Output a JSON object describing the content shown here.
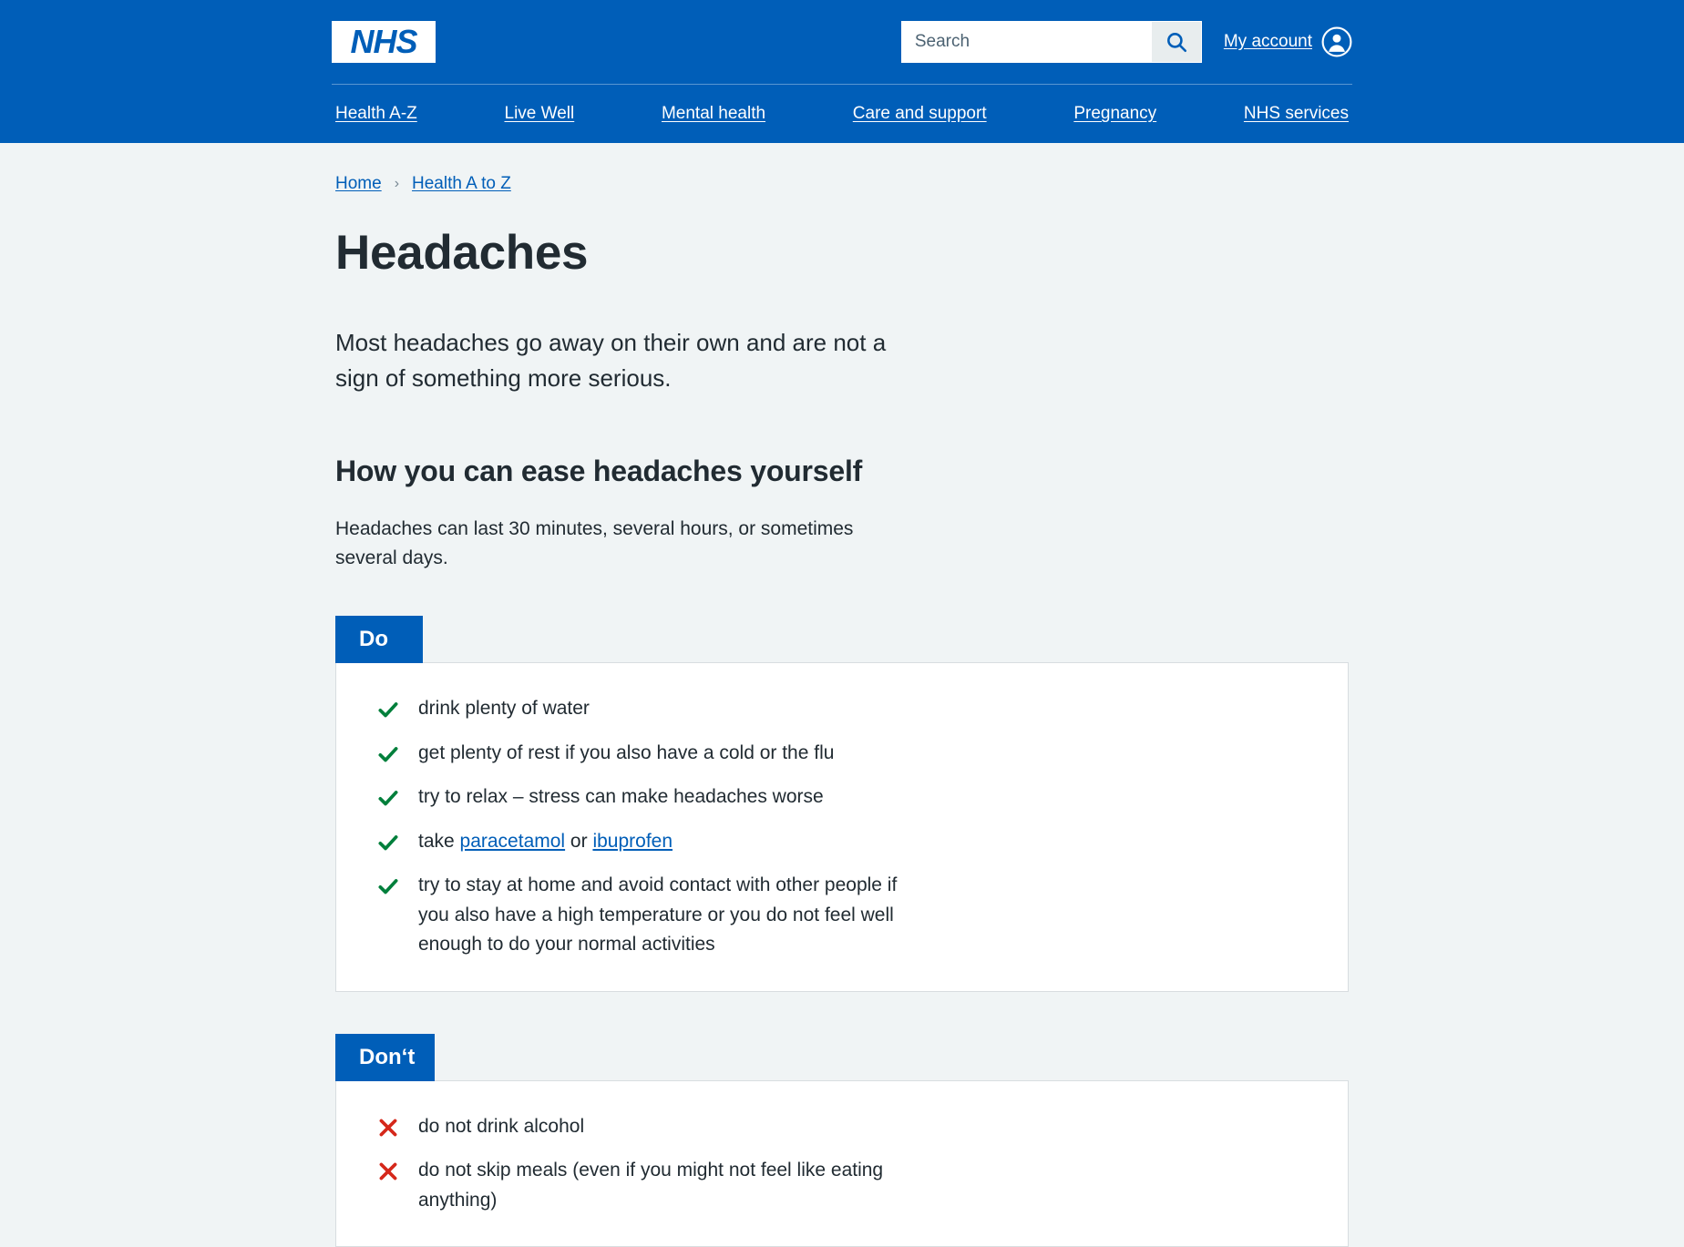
{
  "header": {
    "logo_text": "NHS",
    "search": {
      "placeholder": "Search",
      "value": "",
      "button_label": "Search"
    },
    "account": {
      "label": "My account"
    },
    "nav_items": [
      {
        "label": "Health A-Z"
      },
      {
        "label": "Live Well"
      },
      {
        "label": "Mental health"
      },
      {
        "label": "Care and support"
      },
      {
        "label": "Pregnancy"
      },
      {
        "label": "NHS services"
      }
    ]
  },
  "breadcrumb": {
    "items": [
      {
        "label": "Home"
      },
      {
        "label": "Health A to Z"
      }
    ],
    "separator": "›"
  },
  "main": {
    "title": "Headaches",
    "lede": "Most headaches go away on their own and are not a sign of something more serious.",
    "section_heading": "How you can ease headaches yourself",
    "section_paragraph": "Headaches can last 30 minutes, several hours, or sometimes several days."
  },
  "do_card": {
    "label": "Do",
    "items": [
      {
        "text": "drink plenty of water"
      },
      {
        "text": "get plenty of rest if you also have a cold or the flu"
      },
      {
        "text": "try to relax – stress can make headaches worse"
      },
      {
        "prefix": "take ",
        "link1": "paracetamol",
        "middle": " or ",
        "link2": "ibuprofen",
        "suffix": ""
      },
      {
        "text": "try to stay at home and avoid contact with other people if you also have a high temperature or you do not feel well enough to do your normal activities"
      }
    ]
  },
  "dont_card": {
    "label": "Don‘t",
    "items": [
      {
        "text": "do not drink alcohol"
      },
      {
        "text": "do not skip meals (even if you might not feel like eating anything)"
      }
    ]
  },
  "colors": {
    "nhs_blue": "#005eb8",
    "page_bg": "#f0f4f5",
    "text": "#212b32",
    "link": "#005eb8",
    "tick_green": "#007f3b",
    "cross_red": "#d5281b",
    "card_border": "#d8dde0"
  }
}
